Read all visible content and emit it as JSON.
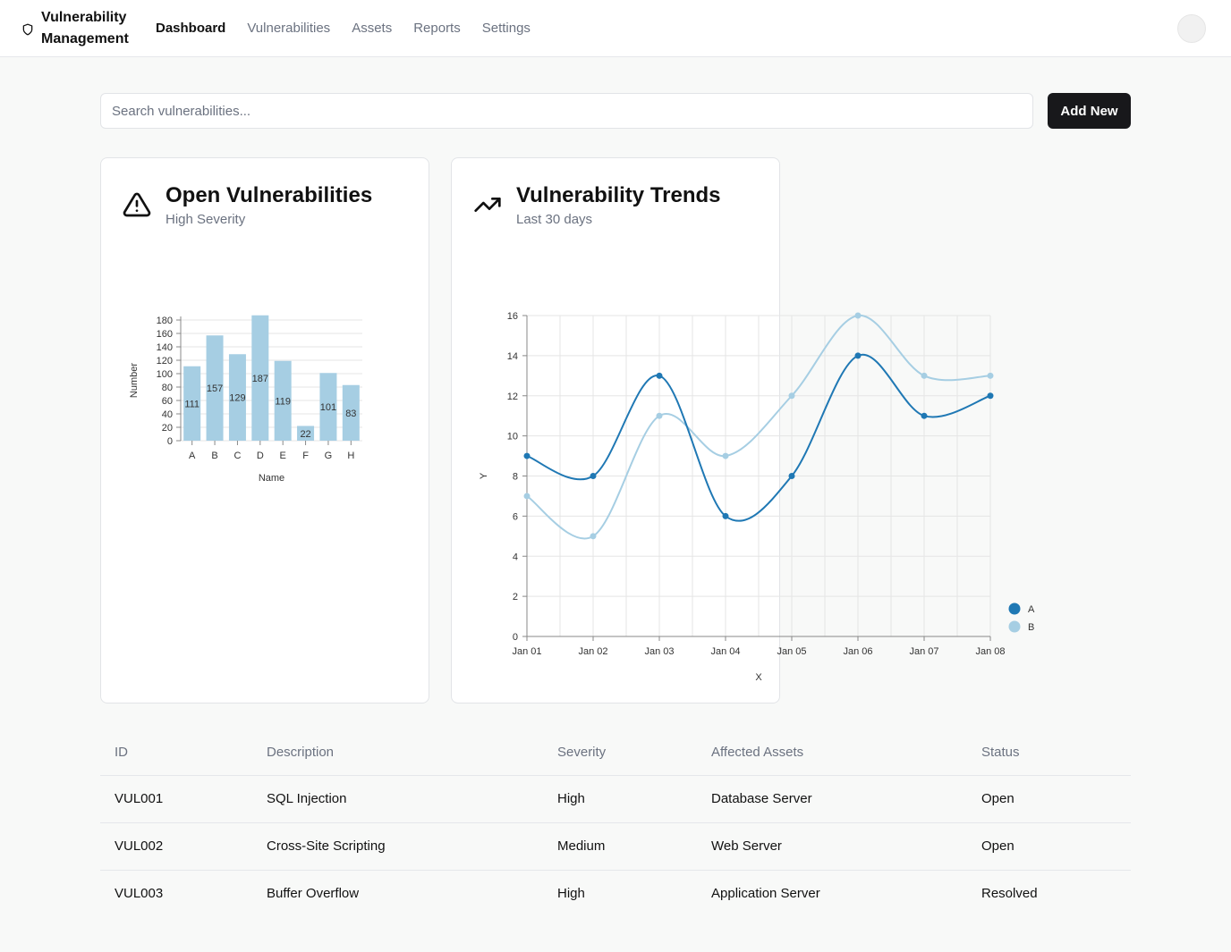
{
  "header": {
    "brand": "Vulnerability Management",
    "nav": [
      "Dashboard",
      "Vulnerabilities",
      "Assets",
      "Reports",
      "Settings"
    ],
    "active_nav": "Dashboard"
  },
  "search": {
    "placeholder": "Search vulnerabilities..."
  },
  "add_button": "Add New",
  "cards": {
    "open": {
      "title": "Open Vulnerabilities",
      "subtitle": "High Severity",
      "icon": "warning-triangle-icon"
    },
    "trends": {
      "title": "Vulnerability Trends",
      "subtitle": "Last 30 days",
      "icon": "trending-up-icon"
    }
  },
  "chart_data": [
    {
      "type": "bar",
      "categories": [
        "A",
        "B",
        "C",
        "D",
        "E",
        "F",
        "G",
        "H"
      ],
      "values": [
        111,
        157,
        129,
        187,
        119,
        22,
        101,
        83
      ],
      "xlabel": "Name",
      "ylabel": "Number",
      "ylim": [
        0,
        180
      ],
      "yticks": [
        0,
        20,
        40,
        60,
        80,
        100,
        120,
        140,
        160,
        180
      ],
      "grid": true,
      "color": "#a6cee3"
    },
    {
      "type": "line",
      "x": [
        "Jan 01",
        "Jan 02",
        "Jan 03",
        "Jan 04",
        "Jan 05",
        "Jan 06",
        "Jan 07",
        "Jan 08"
      ],
      "series": [
        {
          "name": "A",
          "values": [
            9,
            8,
            13,
            6,
            8,
            14,
            11,
            12
          ],
          "color": "#1f78b4"
        },
        {
          "name": "B",
          "values": [
            7,
            5,
            11,
            9,
            12,
            16,
            13,
            13
          ],
          "color": "#a6cee3"
        }
      ],
      "xlabel": "X",
      "ylabel": "Y",
      "ylim": [
        0,
        16
      ],
      "yticks": [
        0,
        2,
        4,
        6,
        8,
        10,
        12,
        14,
        16
      ],
      "grid": true,
      "legend": "right"
    }
  ],
  "table": {
    "headers": [
      "ID",
      "Description",
      "Severity",
      "Affected Assets",
      "Status"
    ],
    "rows": [
      [
        "VUL001",
        "SQL Injection",
        "High",
        "Database Server",
        "Open"
      ],
      [
        "VUL002",
        "Cross-Site Scripting",
        "Medium",
        "Web Server",
        "Open"
      ],
      [
        "VUL003",
        "Buffer Overflow",
        "High",
        "Application Server",
        "Resolved"
      ]
    ]
  }
}
